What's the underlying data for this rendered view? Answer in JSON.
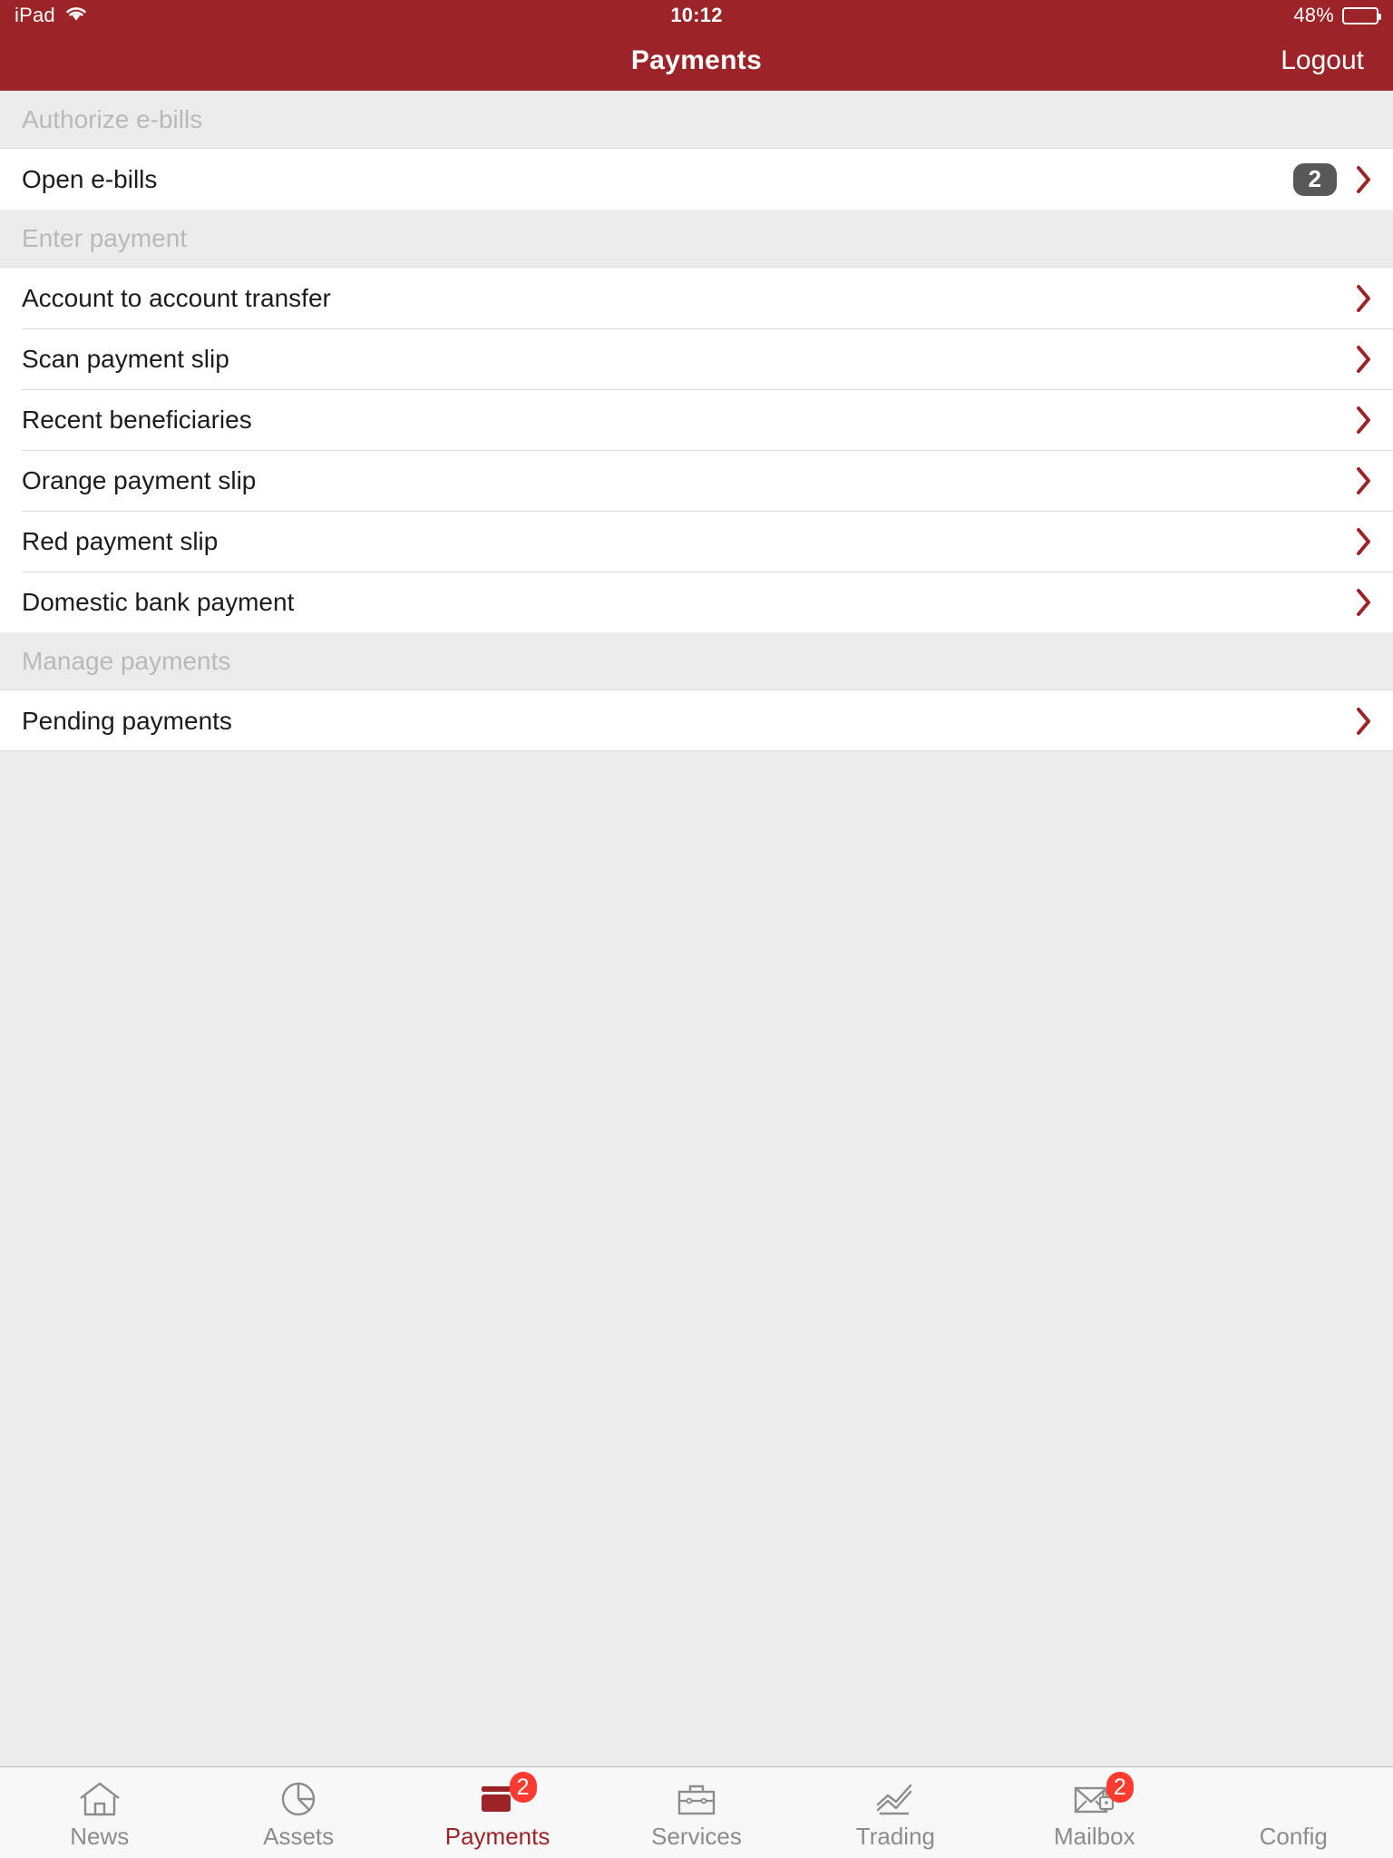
{
  "statusbar": {
    "carrier": "iPad",
    "wifi_icon": "wifi-icon",
    "time": "10:12",
    "battery_percent": "48%",
    "battery_level": 48
  },
  "navbar": {
    "title": "Payments",
    "logout_label": "Logout"
  },
  "colors": {
    "brand_red": "#9c2328",
    "badge_gray": "#585858",
    "badge_red": "#ff3b30",
    "section_bg": "#ececec",
    "row_bg": "#ffffff",
    "tabbar_bg": "#f8f8f8",
    "muted_text": "#b9b9b9"
  },
  "sections": [
    {
      "header": "Authorize e-bills",
      "rows": [
        {
          "label": "Open e-bills",
          "badge": "2",
          "accessory": "chevron-right-icon"
        }
      ]
    },
    {
      "header": "Enter payment",
      "rows": [
        {
          "label": "Account to account transfer",
          "badge": null,
          "accessory": "chevron-right-icon"
        },
        {
          "label": "Scan payment slip",
          "badge": null,
          "accessory": "chevron-right-icon"
        },
        {
          "label": "Recent beneficiaries",
          "badge": null,
          "accessory": "chevron-right-icon"
        },
        {
          "label": "Orange payment slip",
          "badge": null,
          "accessory": "chevron-right-icon"
        },
        {
          "label": "Red payment slip",
          "badge": null,
          "accessory": "chevron-right-icon"
        },
        {
          "label": "Domestic bank payment",
          "badge": null,
          "accessory": "chevron-right-icon"
        }
      ]
    },
    {
      "header": "Manage payments",
      "rows": [
        {
          "label": "Pending payments",
          "badge": null,
          "accessory": "chevron-right-icon"
        }
      ]
    }
  ],
  "tabbar": {
    "tabs": [
      {
        "label": "News",
        "icon": "house-icon",
        "badge": null,
        "active": false
      },
      {
        "label": "Assets",
        "icon": "pie-chart-icon",
        "badge": null,
        "active": false
      },
      {
        "label": "Payments",
        "icon": "credit-card-icon",
        "badge": "2",
        "active": true
      },
      {
        "label": "Services",
        "icon": "briefcase-icon",
        "badge": null,
        "active": false
      },
      {
        "label": "Trading",
        "icon": "line-chart-icon",
        "badge": null,
        "active": false
      },
      {
        "label": "Mailbox",
        "icon": "secure-envelope-icon",
        "badge": "2",
        "active": false
      },
      {
        "label": "Config",
        "icon": null,
        "badge": null,
        "active": false
      }
    ]
  }
}
